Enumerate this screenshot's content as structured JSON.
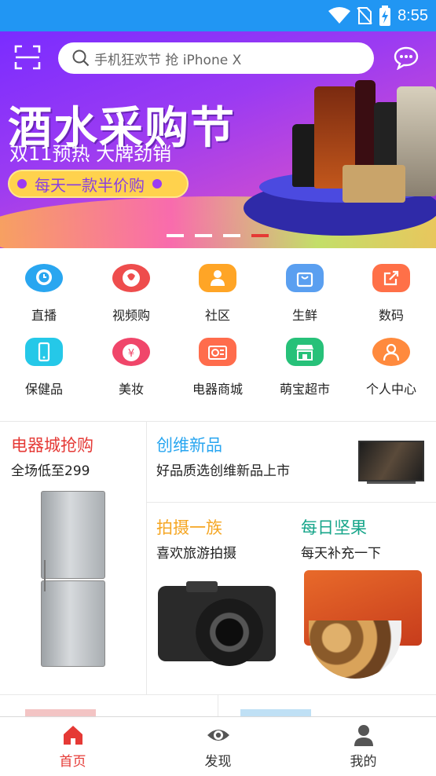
{
  "status_bar": {
    "time": "8:55"
  },
  "search": {
    "placeholder": "手机狂欢节 抢 iPhone X"
  },
  "banner": {
    "title": "酒水采购节",
    "subtitle": "双11预热  大牌劲销",
    "pill": "每天一款半价购",
    "slide_count": 4,
    "active_slide": 4
  },
  "categories": [
    {
      "label": "直播",
      "icon": "clock-pin-icon",
      "color": "#29a6f0"
    },
    {
      "label": "视频购",
      "icon": "video-buy-icon",
      "color": "#ee4d4d"
    },
    {
      "label": "社区",
      "icon": "person-icon",
      "color": "#ffa526"
    },
    {
      "label": "生鲜",
      "icon": "shopping-bag-icon",
      "color": "#5a9ff0"
    },
    {
      "label": "数码",
      "icon": "share-box-icon",
      "color": "#ff7048"
    },
    {
      "label": "保健品",
      "icon": "phone-icon",
      "color": "#25c8e8"
    },
    {
      "label": "美妆",
      "icon": "money-bag-icon",
      "color": "#f0466a"
    },
    {
      "label": "电器商城",
      "icon": "radio-icon",
      "color": "#ff6c4c"
    },
    {
      "label": "萌宝超市",
      "icon": "store-icon",
      "color": "#27c179"
    },
    {
      "label": "个人中心",
      "icon": "user-icon",
      "color": "#ff8a3d"
    }
  ],
  "promos": {
    "appliance": {
      "title": "电器城抢购",
      "subtitle": "全场低至299",
      "color": "#e53935"
    },
    "skyworth": {
      "title": "创维新品",
      "subtitle": "好品质选创维新品上市",
      "color": "#29a6f0"
    },
    "camera": {
      "title": "拍摄一族",
      "subtitle": "喜欢旅游拍摄",
      "color": "#f5a623"
    },
    "nuts": {
      "title": "每日坚果",
      "subtitle": "每天补充一下",
      "color": "#16a58a"
    }
  },
  "tabs": [
    {
      "label": "首页",
      "icon": "home-icon",
      "active": true
    },
    {
      "label": "发现",
      "icon": "eye-icon",
      "active": false
    },
    {
      "label": "我的",
      "icon": "profile-icon",
      "active": false
    }
  ]
}
